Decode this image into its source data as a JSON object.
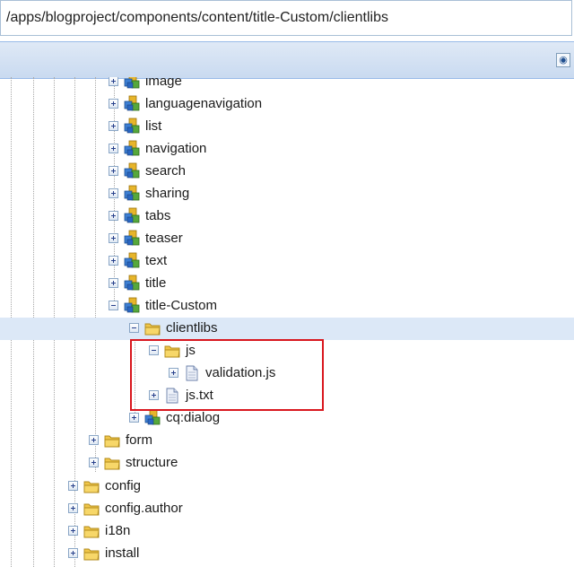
{
  "path_bar": {
    "path": "/apps/blogproject/components/content/title-Custom/clientlibs"
  },
  "toolbar": {
    "search_button_icon": "binoculars-icon"
  },
  "colors": {
    "selection": "#dce8f7",
    "highlight_border": "#d9171e",
    "toolbar": "#c9daf0"
  },
  "tree": {
    "components": [
      {
        "label": "image",
        "icon": "component-icon",
        "expander": "plus"
      },
      {
        "label": "languagenavigation",
        "icon": "component-icon",
        "expander": "plus"
      },
      {
        "label": "list",
        "icon": "component-icon",
        "expander": "plus"
      },
      {
        "label": "navigation",
        "icon": "component-icon",
        "expander": "plus"
      },
      {
        "label": "search",
        "icon": "component-icon",
        "expander": "plus"
      },
      {
        "label": "sharing",
        "icon": "component-icon",
        "expander": "plus"
      },
      {
        "label": "tabs",
        "icon": "component-icon",
        "expander": "plus"
      },
      {
        "label": "teaser",
        "icon": "component-icon",
        "expander": "plus"
      },
      {
        "label": "text",
        "icon": "component-icon",
        "expander": "plus"
      },
      {
        "label": "title",
        "icon": "component-icon",
        "expander": "plus"
      },
      {
        "label": "title-Custom",
        "icon": "component-icon",
        "expander": "minus"
      }
    ],
    "clientlibs": {
      "label": "clientlibs",
      "icon": "folder-icon",
      "expander": "minus",
      "selected": true
    },
    "js_folder": {
      "label": "js",
      "icon": "folder-icon",
      "expander": "minus"
    },
    "validation_js": {
      "label": "validation.js",
      "icon": "file-icon",
      "expander": "plus"
    },
    "js_txt": {
      "label": "js.txt",
      "icon": "file-icon",
      "expander": "plus"
    },
    "cq_dialog": {
      "label": "cq:dialog",
      "icon": "component-icon",
      "expander": "plus"
    },
    "form": {
      "label": "form",
      "icon": "folder-icon",
      "expander": "plus"
    },
    "structure": {
      "label": "structure",
      "icon": "folder-icon",
      "expander": "plus"
    },
    "config": {
      "label": "config",
      "icon": "folder-icon",
      "expander": "plus"
    },
    "config_author": {
      "label": "config.author",
      "icon": "folder-icon",
      "expander": "plus"
    },
    "i18n": {
      "label": "i18n",
      "icon": "folder-icon",
      "expander": "plus"
    },
    "install": {
      "label": "install",
      "icon": "folder-icon",
      "expander": "plus"
    }
  }
}
